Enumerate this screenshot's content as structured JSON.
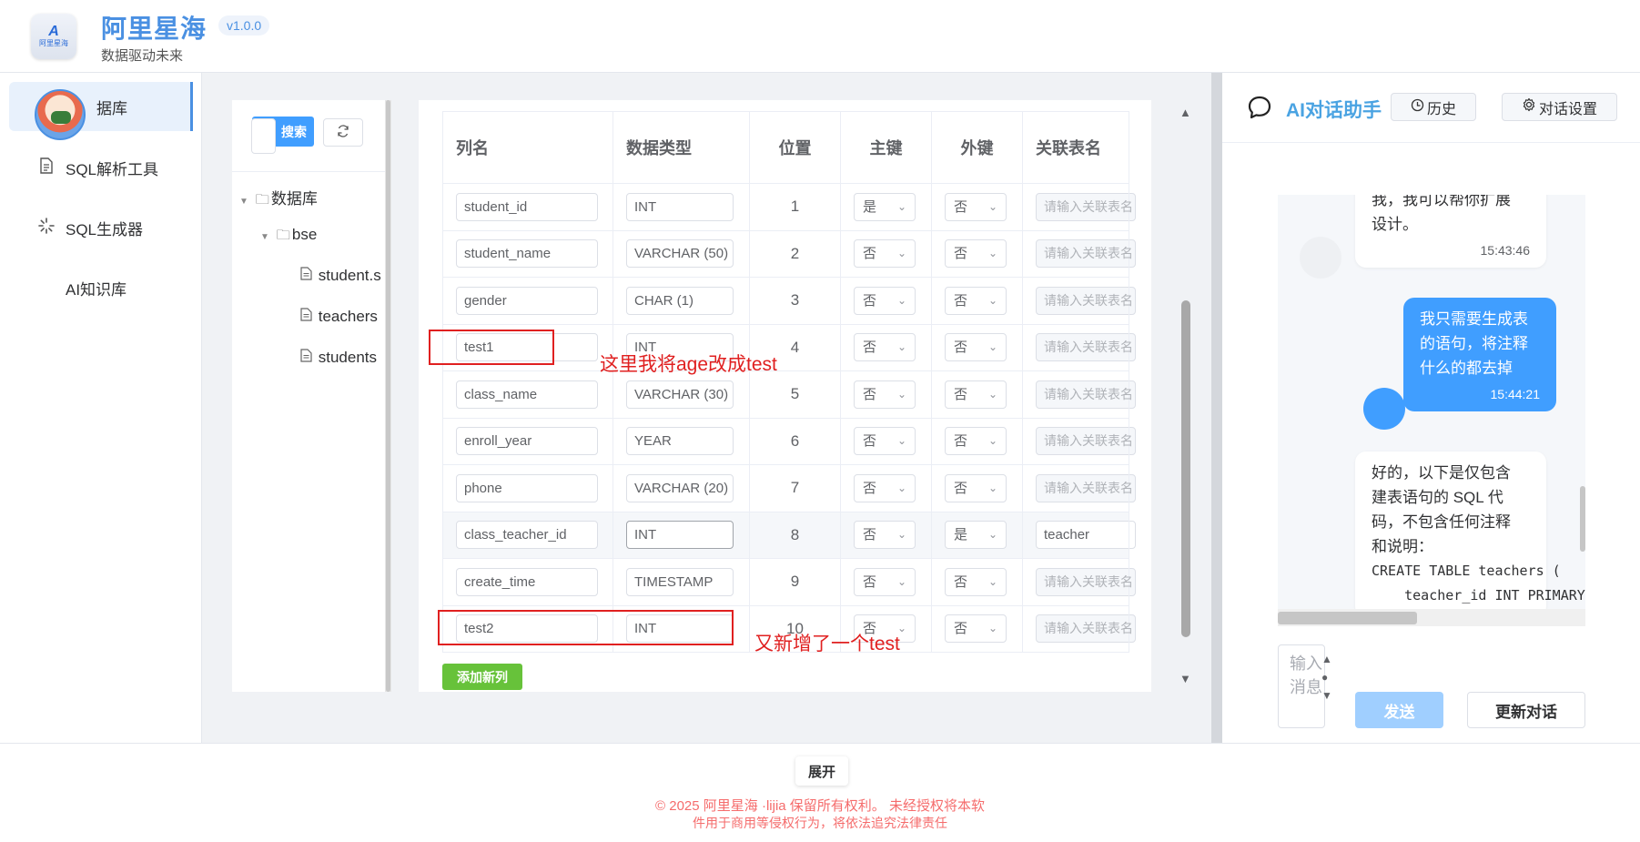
{
  "header": {
    "logo_mark": "A",
    "logo_text": "阿里星海",
    "title": "阿里星海",
    "version": "v1.0.0",
    "tagline": "数据驱动未来"
  },
  "nav": {
    "items": [
      {
        "label": "据库",
        "icon": "database-icon",
        "active": true
      },
      {
        "label": "SQL解析工具",
        "icon": "document-icon"
      },
      {
        "label": "SQL生成器",
        "icon": "loading-icon"
      },
      {
        "label": "AI知识库",
        "icon": ""
      }
    ]
  },
  "tree": {
    "search_label": "搜索",
    "root": "数据库",
    "db": "bse",
    "tables": [
      "student.s",
      "teachers",
      "students"
    ]
  },
  "columns_table": {
    "headers": [
      "列名",
      "数据类型",
      "位置",
      "主键",
      "外键",
      "关联表名"
    ],
    "ref_placeholder": "请输入关联表名",
    "rows": [
      {
        "name": "student_id",
        "type": "INT",
        "pos": "1",
        "pk": "是",
        "fk": "否",
        "ref": ""
      },
      {
        "name": "student_name",
        "type": "VARCHAR (50)",
        "pos": "2",
        "pk": "否",
        "fk": "否",
        "ref": ""
      },
      {
        "name": "gender",
        "type": "CHAR (1)",
        "pos": "3",
        "pk": "否",
        "fk": "否",
        "ref": ""
      },
      {
        "name": "test1",
        "type": "INT",
        "pos": "4",
        "pk": "否",
        "fk": "否",
        "ref": ""
      },
      {
        "name": "class_name",
        "type": "VARCHAR (30)",
        "pos": "5",
        "pk": "否",
        "fk": "否",
        "ref": ""
      },
      {
        "name": "enroll_year",
        "type": "YEAR",
        "pos": "6",
        "pk": "否",
        "fk": "否",
        "ref": ""
      },
      {
        "name": "phone",
        "type": "VARCHAR (20)",
        "pos": "7",
        "pk": "否",
        "fk": "否",
        "ref": ""
      },
      {
        "name": "class_teacher_id",
        "type": "INT",
        "pos": "8",
        "pk": "否",
        "fk": "是",
        "ref": "teacher"
      },
      {
        "name": "create_time",
        "type": "TIMESTAMP",
        "pos": "9",
        "pk": "否",
        "fk": "否",
        "ref": ""
      },
      {
        "name": "test2",
        "type": "INT",
        "pos": "10",
        "pk": "否",
        "fk": "否",
        "ref": ""
      }
    ],
    "add_label": "添加新列"
  },
  "annotations": {
    "note1": "这里我将age改成test",
    "note2": "又新增了一个test"
  },
  "chat": {
    "title": "AI对话助手",
    "history_label": "历史",
    "settings_label": "对话设置",
    "messages": [
      {
        "role": "ai",
        "text_top": "我，我可以帮你扩展",
        "text": "设计。",
        "time": "15:43:46"
      },
      {
        "role": "user",
        "lines": [
          "我只需要生成表",
          "的语句，将注释",
          "什么的都去掉"
        ],
        "time": "15:44:21"
      },
      {
        "role": "ai",
        "lines": [
          "好的，以下是仅包含",
          "建表语句的 SQL 代",
          "码，不包含任何注释",
          "和说明："
        ],
        "code": [
          "CREATE TABLE teachers (",
          "    teacher_id INT PRIMARY"
        ]
      }
    ],
    "input_placeholder": "输入消息",
    "send_label": "发送",
    "renew_label": "更新对话"
  },
  "footer": {
    "expand_label": "展开",
    "copyright_1": "© 2025 阿里星海 ·lijia 保留所有权利。 未经授权将本软",
    "copyright_2": "件用于商用等侵权行为，将依法追究法律责任"
  },
  "colors": {
    "primary": "#409eff",
    "brand": "#4a90e2",
    "success": "#67c23a",
    "annotation": "#e02020",
    "footer_text": "#f56c6c"
  }
}
